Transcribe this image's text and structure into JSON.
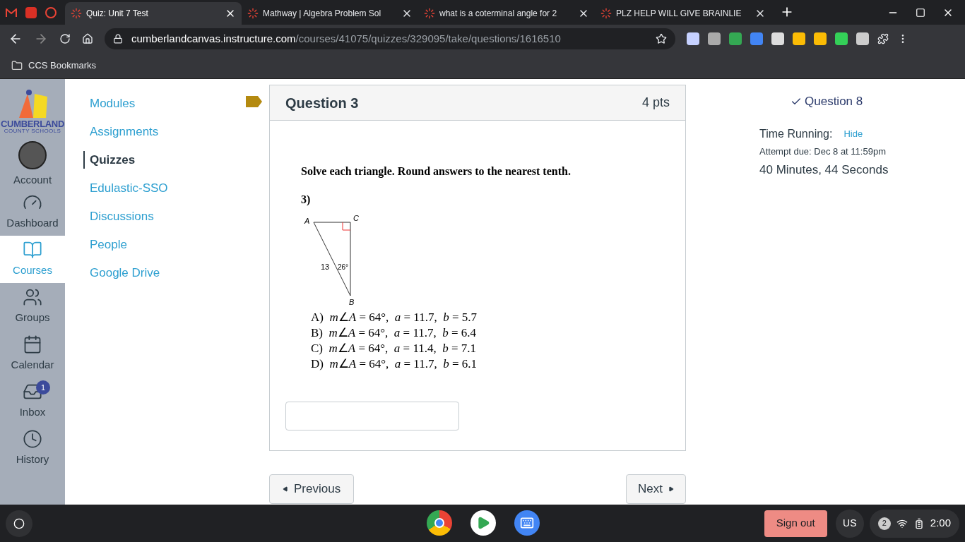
{
  "browser": {
    "tabs": [
      {
        "title": "Quiz: Unit 7 Test",
        "selected": true
      },
      {
        "title": "Mathway | Algebra Problem Sol",
        "selected": false
      },
      {
        "title": "what is a coterminal angle for 2",
        "selected": false
      },
      {
        "title": "PLZ HELP WILL GIVE BRAINLIE",
        "selected": false
      }
    ],
    "url_host": "cumberlandcanvas.instructure.com",
    "url_path": "/courses/41075/quizzes/329095/take/questions/1616510",
    "bookmark": "CCS Bookmarks"
  },
  "global_nav": {
    "logo_top": "CUMBERLAND",
    "logo_bottom": "COUNTY SCHOOLS",
    "items": [
      {
        "kind": "account",
        "label": "Account",
        "selected": false
      },
      {
        "kind": "dashboard",
        "label": "Dashboard",
        "selected": false
      },
      {
        "kind": "courses",
        "label": "Courses",
        "selected": true
      },
      {
        "kind": "groups",
        "label": "Groups",
        "selected": false
      },
      {
        "kind": "calendar",
        "label": "Calendar",
        "selected": false
      },
      {
        "kind": "inbox",
        "label": "Inbox",
        "selected": false,
        "badge": "1"
      },
      {
        "kind": "history",
        "label": "History",
        "selected": false
      }
    ]
  },
  "course_nav": [
    {
      "label": "Modules",
      "selected": false
    },
    {
      "label": "Assignments",
      "selected": false
    },
    {
      "label": "Quizzes",
      "selected": true
    },
    {
      "label": "Edulastic-SSO",
      "selected": false
    },
    {
      "label": "Discussions",
      "selected": false
    },
    {
      "label": "People",
      "selected": false
    },
    {
      "label": "Google Drive",
      "selected": false
    }
  ],
  "question": {
    "title": "Question 3",
    "points": "4 pts",
    "instruction": "Solve each triangle.  Round answers to the nearest tenth.",
    "number": "3)",
    "figure": {
      "vertex_a": "A",
      "vertex_b": "B",
      "vertex_c": "C",
      "side": "13",
      "angle": "26°"
    },
    "options": [
      "A)  *m*∠*A* = 64°,  *a* = 11.7,  *b* = 5.7",
      "B)  *m*∠*A* = 64°,  *a* = 11.7,  *b* = 6.4",
      "C)  *m*∠*A* = 64°,  *a* = 11.4,  *b* = 7.1",
      "D)  *m*∠*A* = 64°,  *a* = 11.7,  *b* = 6.1"
    ]
  },
  "pager": {
    "previous": "Previous",
    "next": "Next"
  },
  "sidebar": {
    "questions": [
      {
        "label": "Question 8",
        "answered": true
      }
    ],
    "timer_label": "Time Running:",
    "hide": "Hide",
    "due": "Attempt due: Dec 8 at 11:59pm",
    "elapsed": "40 Minutes, 44 Seconds"
  },
  "shelf": {
    "sign_out": "Sign out",
    "ime": "US",
    "notifications": "2",
    "time": "2:00"
  }
}
